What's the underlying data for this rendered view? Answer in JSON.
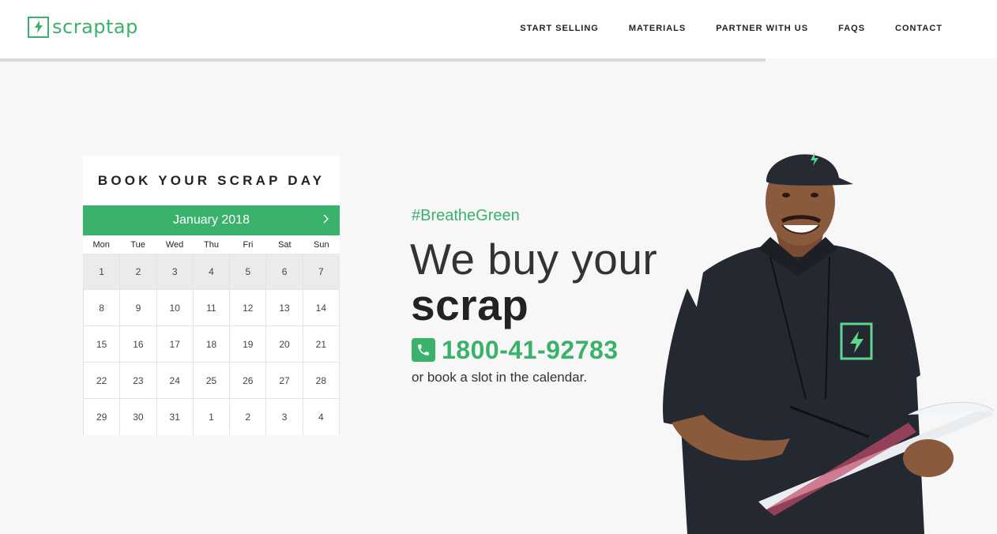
{
  "brand": {
    "name": "scraptap",
    "accent": "#3ab26b"
  },
  "nav": [
    {
      "label": "START SELLING"
    },
    {
      "label": "MATERIALS"
    },
    {
      "label": "PARTNER WITH US"
    },
    {
      "label": "FAQS"
    },
    {
      "label": "CONTACT"
    }
  ],
  "booking": {
    "title": "BOOK YOUR SCRAP DAY",
    "month": "January 2018",
    "weekdays": [
      "Mon",
      "Tue",
      "Wed",
      "Thu",
      "Fri",
      "Sat",
      "Sun"
    ],
    "days": [
      "1",
      "2",
      "3",
      "4",
      "5",
      "6",
      "7",
      "8",
      "9",
      "10",
      "11",
      "12",
      "13",
      "14",
      "15",
      "16",
      "17",
      "18",
      "19",
      "20",
      "21",
      "22",
      "23",
      "24",
      "25",
      "26",
      "27",
      "28",
      "29",
      "30",
      "31",
      "1",
      "2",
      "3",
      "4"
    ],
    "past_days": [
      "1",
      "2",
      "3",
      "4",
      "5",
      "6",
      "7"
    ],
    "next_icon": "chevron-right-icon"
  },
  "hero": {
    "hashtag": "#BreatheGreen",
    "headline": "We buy your",
    "headline_bold": "scrap",
    "phone": "1800-41-92783",
    "phone_icon": "phone-icon",
    "subtext": "or book a slot in the calendar."
  }
}
